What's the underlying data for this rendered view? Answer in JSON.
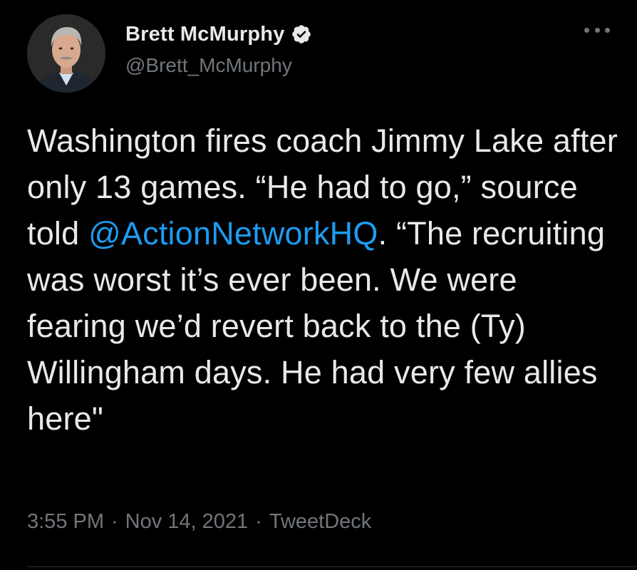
{
  "author": {
    "display_name": "Brett McMurphy",
    "handle": "@Brett_McMurphy",
    "verified": true,
    "avatar_icon": "profile-photo"
  },
  "tweet": {
    "text_before_mention": "Washington fires coach Jimmy Lake after only 13 games. “He had to go,” source told ",
    "mention": "@ActionNetworkHQ",
    "text_after_mention": ". “The recruiting was worst it’s ever been. We were fearing we’d revert back to the (Ty) Willingham days. He had very few allies here\""
  },
  "meta": {
    "time": "3:55 PM",
    "separator": "·",
    "date": "Nov 14, 2021",
    "client": "TweetDeck"
  },
  "icons": {
    "more": "more-options-icon",
    "verified": "verified-badge-icon"
  },
  "colors": {
    "background": "#000000",
    "text": "#e7e9ea",
    "secondary": "#71767b",
    "link": "#1d9bf0"
  }
}
